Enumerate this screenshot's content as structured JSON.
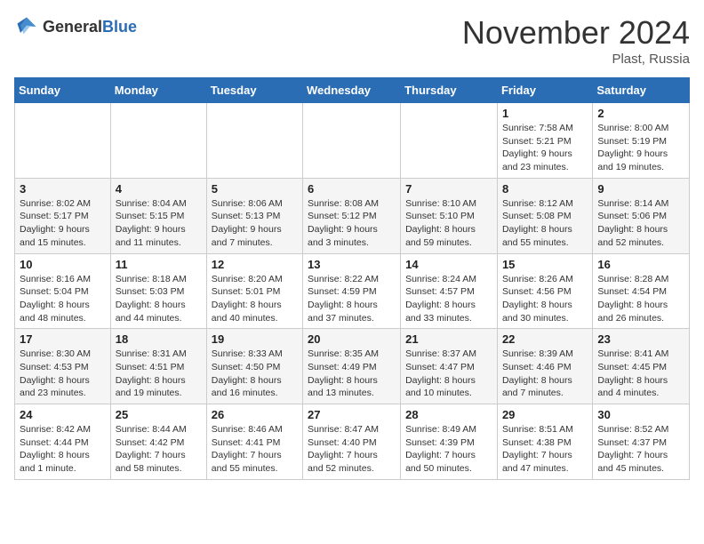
{
  "logo": {
    "general": "General",
    "blue": "Blue"
  },
  "header": {
    "month": "November 2024",
    "location": "Plast, Russia"
  },
  "days_of_week": [
    "Sunday",
    "Monday",
    "Tuesday",
    "Wednesday",
    "Thursday",
    "Friday",
    "Saturday"
  ],
  "weeks": [
    [
      {
        "day": "",
        "info": ""
      },
      {
        "day": "",
        "info": ""
      },
      {
        "day": "",
        "info": ""
      },
      {
        "day": "",
        "info": ""
      },
      {
        "day": "",
        "info": ""
      },
      {
        "day": "1",
        "info": "Sunrise: 7:58 AM\nSunset: 5:21 PM\nDaylight: 9 hours and 23 minutes."
      },
      {
        "day": "2",
        "info": "Sunrise: 8:00 AM\nSunset: 5:19 PM\nDaylight: 9 hours and 19 minutes."
      }
    ],
    [
      {
        "day": "3",
        "info": "Sunrise: 8:02 AM\nSunset: 5:17 PM\nDaylight: 9 hours and 15 minutes."
      },
      {
        "day": "4",
        "info": "Sunrise: 8:04 AM\nSunset: 5:15 PM\nDaylight: 9 hours and 11 minutes."
      },
      {
        "day": "5",
        "info": "Sunrise: 8:06 AM\nSunset: 5:13 PM\nDaylight: 9 hours and 7 minutes."
      },
      {
        "day": "6",
        "info": "Sunrise: 8:08 AM\nSunset: 5:12 PM\nDaylight: 9 hours and 3 minutes."
      },
      {
        "day": "7",
        "info": "Sunrise: 8:10 AM\nSunset: 5:10 PM\nDaylight: 8 hours and 59 minutes."
      },
      {
        "day": "8",
        "info": "Sunrise: 8:12 AM\nSunset: 5:08 PM\nDaylight: 8 hours and 55 minutes."
      },
      {
        "day": "9",
        "info": "Sunrise: 8:14 AM\nSunset: 5:06 PM\nDaylight: 8 hours and 52 minutes."
      }
    ],
    [
      {
        "day": "10",
        "info": "Sunrise: 8:16 AM\nSunset: 5:04 PM\nDaylight: 8 hours and 48 minutes."
      },
      {
        "day": "11",
        "info": "Sunrise: 8:18 AM\nSunset: 5:03 PM\nDaylight: 8 hours and 44 minutes."
      },
      {
        "day": "12",
        "info": "Sunrise: 8:20 AM\nSunset: 5:01 PM\nDaylight: 8 hours and 40 minutes."
      },
      {
        "day": "13",
        "info": "Sunrise: 8:22 AM\nSunset: 4:59 PM\nDaylight: 8 hours and 37 minutes."
      },
      {
        "day": "14",
        "info": "Sunrise: 8:24 AM\nSunset: 4:57 PM\nDaylight: 8 hours and 33 minutes."
      },
      {
        "day": "15",
        "info": "Sunrise: 8:26 AM\nSunset: 4:56 PM\nDaylight: 8 hours and 30 minutes."
      },
      {
        "day": "16",
        "info": "Sunrise: 8:28 AM\nSunset: 4:54 PM\nDaylight: 8 hours and 26 minutes."
      }
    ],
    [
      {
        "day": "17",
        "info": "Sunrise: 8:30 AM\nSunset: 4:53 PM\nDaylight: 8 hours and 23 minutes."
      },
      {
        "day": "18",
        "info": "Sunrise: 8:31 AM\nSunset: 4:51 PM\nDaylight: 8 hours and 19 minutes."
      },
      {
        "day": "19",
        "info": "Sunrise: 8:33 AM\nSunset: 4:50 PM\nDaylight: 8 hours and 16 minutes."
      },
      {
        "day": "20",
        "info": "Sunrise: 8:35 AM\nSunset: 4:49 PM\nDaylight: 8 hours and 13 minutes."
      },
      {
        "day": "21",
        "info": "Sunrise: 8:37 AM\nSunset: 4:47 PM\nDaylight: 8 hours and 10 minutes."
      },
      {
        "day": "22",
        "info": "Sunrise: 8:39 AM\nSunset: 4:46 PM\nDaylight: 8 hours and 7 minutes."
      },
      {
        "day": "23",
        "info": "Sunrise: 8:41 AM\nSunset: 4:45 PM\nDaylight: 8 hours and 4 minutes."
      }
    ],
    [
      {
        "day": "24",
        "info": "Sunrise: 8:42 AM\nSunset: 4:44 PM\nDaylight: 8 hours and 1 minute."
      },
      {
        "day": "25",
        "info": "Sunrise: 8:44 AM\nSunset: 4:42 PM\nDaylight: 7 hours and 58 minutes."
      },
      {
        "day": "26",
        "info": "Sunrise: 8:46 AM\nSunset: 4:41 PM\nDaylight: 7 hours and 55 minutes."
      },
      {
        "day": "27",
        "info": "Sunrise: 8:47 AM\nSunset: 4:40 PM\nDaylight: 7 hours and 52 minutes."
      },
      {
        "day": "28",
        "info": "Sunrise: 8:49 AM\nSunset: 4:39 PM\nDaylight: 7 hours and 50 minutes."
      },
      {
        "day": "29",
        "info": "Sunrise: 8:51 AM\nSunset: 4:38 PM\nDaylight: 7 hours and 47 minutes."
      },
      {
        "day": "30",
        "info": "Sunrise: 8:52 AM\nSunset: 4:37 PM\nDaylight: 7 hours and 45 minutes."
      }
    ]
  ]
}
